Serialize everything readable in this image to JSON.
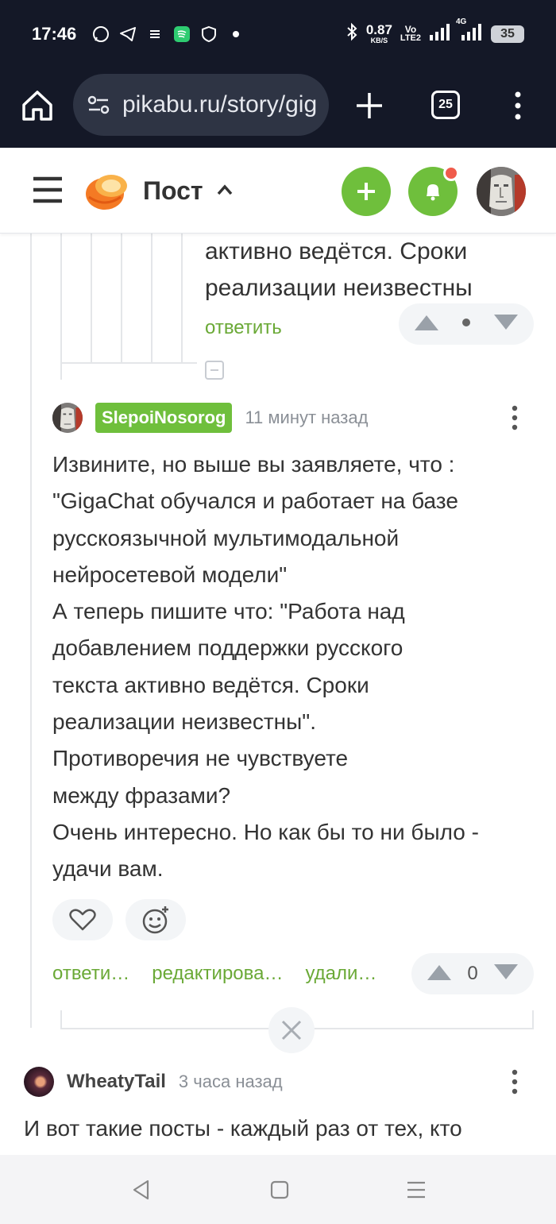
{
  "statusbar": {
    "time": "17:46",
    "net_speed_top": "0.87",
    "net_speed_bottom": "KB/S",
    "volte_top": "Vo",
    "volte_bottom": "LTE2",
    "net_type": "4G",
    "battery": "35"
  },
  "browser": {
    "url": "pikabu.ru/story/gig",
    "tab_count": "25"
  },
  "header": {
    "title": "Пост",
    "colors": {
      "accent": "#6fbf3c",
      "notif": "#f05b4b"
    }
  },
  "prev_comment": {
    "text_line1": "активно ведётся. Сроки",
    "text_line2": "реализации неизвестны",
    "reply": "ответить"
  },
  "comment": {
    "author": "SlepoiNosorog",
    "time": "11 минут назад",
    "body": "Извините, но выше вы заявляете, что :\n\"GigaChat обучался и работает на базе\nрусскоязычной мультимодальной\nнейросетевой модели\"\nА теперь пишите что: \"Работа над\nдобавлением поддержки русского\nтекста активно ведётся. Сроки\nреализации неизвестны\".\nПротиворечия не чувствуете\nмежду фразами?\nОчень интересно. Но как бы то ни было -\nудачи вам.",
    "actions": {
      "reply": "ответи…",
      "edit": "редактирова…",
      "delete": "удали…"
    },
    "rating": "0"
  },
  "comment2": {
    "author": "WheatyTail",
    "time": "3 часа назад",
    "body_line1": "И вот такие посты - каждый раз от тех, кто"
  }
}
